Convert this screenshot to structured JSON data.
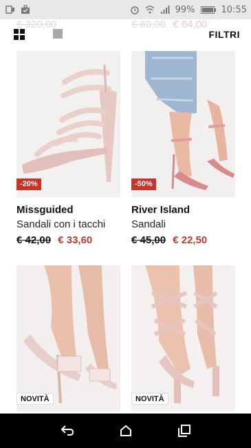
{
  "status_bar": {
    "battery_percent": "99%",
    "time": "10:55",
    "icons": [
      "notification-card-icon",
      "briefcase-check-icon",
      "alarm-icon",
      "wifi-icon",
      "signal-icon",
      "battery-icon"
    ]
  },
  "toolbar": {
    "filter_label": "FILTRI",
    "view_icons": [
      "grid-view-icon",
      "single-view-icon"
    ]
  },
  "previous_row": {
    "left_price": "€ 320,00",
    "right_old": "€ 80,00",
    "right_new": "€ 64,00"
  },
  "products": [
    {
      "brand": "Missguided",
      "description": "Sandali con i tacchi",
      "old_price": "€ 42,00",
      "price": "€ 33,60",
      "badge": "-20%",
      "badge_type": "sale"
    },
    {
      "brand": "River Island",
      "description": "Sandali",
      "old_price": "€ 45,00",
      "price": "€ 22,50",
      "badge": "-50%",
      "badge_type": "sale"
    },
    {
      "badge": "NOVITÀ",
      "badge_type": "new"
    },
    {
      "badge": "NOVITÀ",
      "badge_type": "new"
    }
  ],
  "nav_bar": {
    "icons": [
      "back-icon",
      "home-icon",
      "recents-icon"
    ]
  },
  "colors": {
    "sale_red": "#c8332a",
    "price_red": "#c0392b",
    "status_bar_bg": "#e8e8e8",
    "nav_bar_bg": "#000000"
  }
}
